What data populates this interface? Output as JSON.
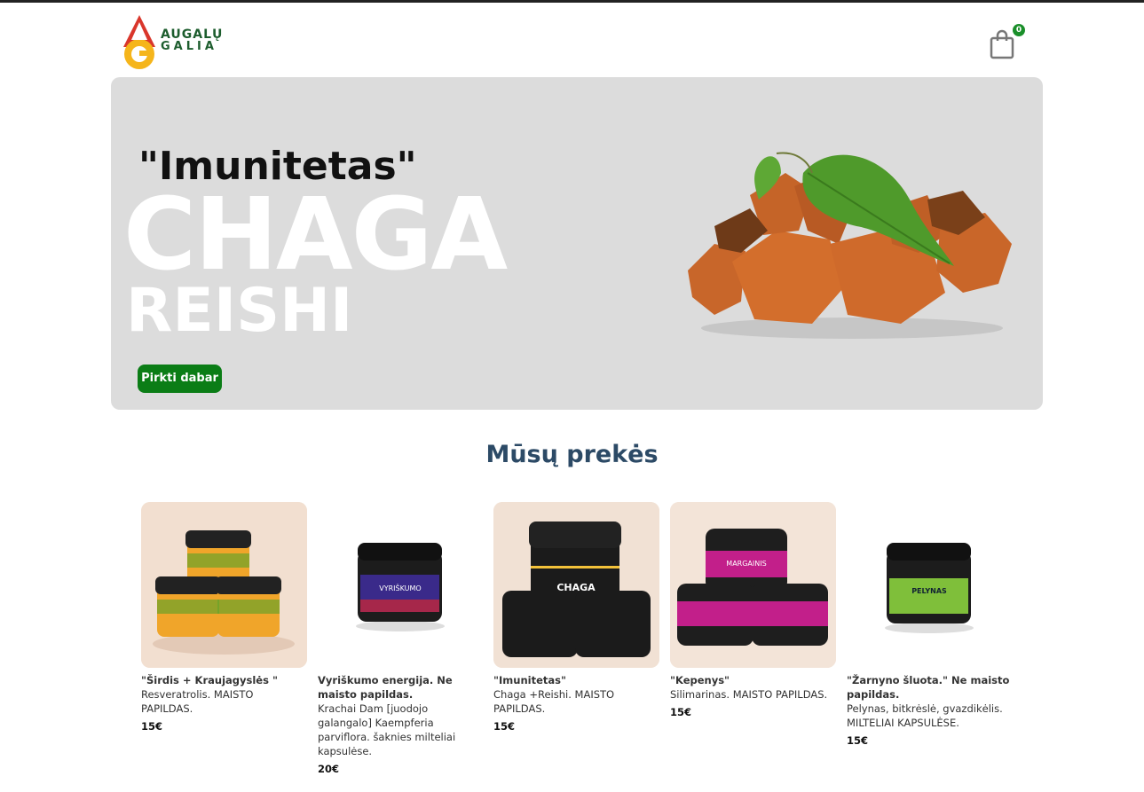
{
  "brand": {
    "line1": "AUGALŲ",
    "line2": "GALIA"
  },
  "cart": {
    "count": "0"
  },
  "hero": {
    "subtitle": "\"Imunitetas\"",
    "title_big": "CHAGA",
    "title_mid": "REISHI",
    "button": "Pirkti dabar"
  },
  "section": {
    "title": "Mūsų prekės"
  },
  "products": [
    {
      "name": "\"Širdis + Kraujagyslės \"",
      "desc": "Resveratrolis. MAISTO PAPILDAS.",
      "price": "15€",
      "jar_label": ""
    },
    {
      "name": "Vyriškumo energija. Ne maisto papildas.",
      "desc": "Krachai Dam [juodojo galangalo] Kaempferia parviflora. šaknies milteliai kapsulėse.",
      "price": "20€",
      "jar_label": "VYRIŠKUMO ENERGIJA KRACHAI-DAM"
    },
    {
      "name": "\"Imunitetas\"",
      "desc": "Chaga +Reishi. MAISTO PAPILDAS.",
      "price": "15€",
      "jar_label": "CHAGA + REISHI"
    },
    {
      "name": "\"Kepenys\"",
      "desc": "Silimarinas. MAISTO PAPILDAS.",
      "price": "15€",
      "jar_label": "MARGAINIS DAŽINĖ CIBERŽOLĖ JUODASIS PIPIRAS"
    },
    {
      "name": "\"Žarnyno šluota.\" Ne maisto papildas.",
      "desc": "Pelynas, bitkrėslė, gvazdikėlis. MILTELIAI KAPSULĖSE.",
      "price": "15€",
      "jar_label": "PELYNAS BITKRĖSLĖ GVAZDIKĖLIS"
    }
  ],
  "colors": {
    "accent": "#0b7d16",
    "title": "#2c4a66",
    "hero_bg": "#dcdcdc"
  }
}
